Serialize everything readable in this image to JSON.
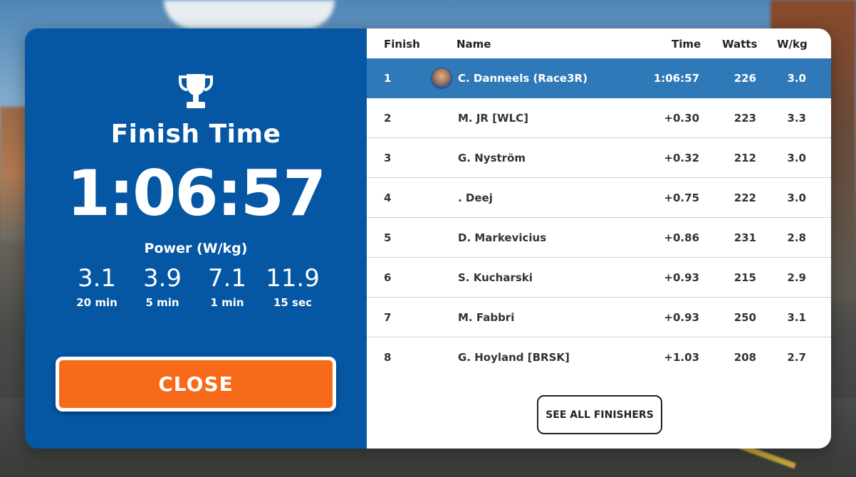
{
  "summary": {
    "title": "Finish Time",
    "time": "1:06:57",
    "power_title": "Power (W/kg)",
    "power": [
      {
        "value": "3.1",
        "label": "20 min"
      },
      {
        "value": "3.9",
        "label": "5 min"
      },
      {
        "value": "7.1",
        "label": "1 min"
      },
      {
        "value": "11.9",
        "label": "15 sec"
      }
    ],
    "close_label": "CLOSE",
    "icon": "trophy-icon"
  },
  "table": {
    "headers": {
      "finish": "Finish",
      "name": "Name",
      "time": "Time",
      "watts": "Watts",
      "wkg": "W/kg"
    },
    "rows": [
      {
        "finish": "1",
        "name": "C. Danneels (Race3R)",
        "time": "1:06:57",
        "watts": "226",
        "wkg": "3.0"
      },
      {
        "finish": "2",
        "name": "M. JR [WLC]",
        "time": "+0.30",
        "watts": "223",
        "wkg": "3.3"
      },
      {
        "finish": "3",
        "name": "G. Nyström",
        "time": "+0.32",
        "watts": "212",
        "wkg": "3.0"
      },
      {
        "finish": "4",
        "name": ". Deej",
        "time": "+0.75",
        "watts": "222",
        "wkg": "3.0"
      },
      {
        "finish": "5",
        "name": "D. Markevicius",
        "time": "+0.86",
        "watts": "231",
        "wkg": "2.8"
      },
      {
        "finish": "6",
        "name": "S. Kucharski",
        "time": "+0.93",
        "watts": "215",
        "wkg": "2.9"
      },
      {
        "finish": "7",
        "name": "M. Fabbri",
        "time": "+0.93",
        "watts": "250",
        "wkg": "3.1"
      },
      {
        "finish": "8",
        "name": "G. Hoyland  [BRSK]",
        "time": "+1.03",
        "watts": "208",
        "wkg": "2.7"
      }
    ],
    "see_all_label": "SEE ALL FINISHERS"
  },
  "colors": {
    "panel_blue": "#0556a3",
    "highlight_blue": "#2f79b9",
    "close_orange": "#f76a1a"
  }
}
